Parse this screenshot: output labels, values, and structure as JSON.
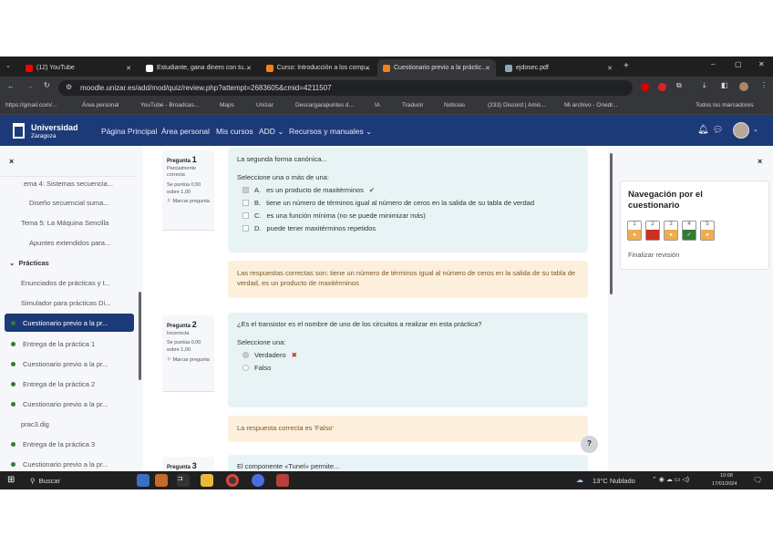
{
  "browser": {
    "tabs": [
      {
        "label": "(12) YouTube",
        "active": false
      },
      {
        "label": "Estudiante, gana dinero con tu...",
        "active": false
      },
      {
        "label": "Curso: Introducción a los comp...",
        "active": false
      },
      {
        "label": "Cuestionario previo a la práctic...",
        "active": true
      },
      {
        "label": "ejdosec.pdf",
        "active": false
      }
    ],
    "url": "moodle.unizar.es/add/mod/quiz/review.php?attempt=2683605&cmid=4211507",
    "bookmarks": [
      "https://gmail.com/...",
      "Área personal",
      "YouTube - Broadcas...",
      "Maps",
      "Unizar",
      "Descargarapuntes d...",
      "IA",
      "Traducir",
      "Noticias",
      "(233) Discord | Amis...",
      "Mi archivo - Onedr..."
    ],
    "all_bookmarks": "Todos los marcadores"
  },
  "moodle": {
    "brand_line1": "Universidad",
    "brand_line2": "Zaragoza",
    "nav": [
      "Página Principal",
      "Área personal",
      "Mis cursos",
      "ADD",
      "Recursos y manuales"
    ]
  },
  "drawer": {
    "close": "×",
    "items": [
      {
        "label": "ema 4: Sistemas secuencia...",
        "dot": false
      },
      {
        "label": "Diseño secuencial suma...",
        "dot": false
      },
      {
        "label": "Tema 5: La Máquina Sencilla",
        "dot": false
      },
      {
        "label": "Apuntes extendidos para...",
        "dot": false
      },
      {
        "label": "Enunciados de prácticas y t...",
        "dot": false
      },
      {
        "label": "Simulador para prácticas Di...",
        "dot": false
      },
      {
        "label": "Cuestionario previo a la pr...",
        "dot": true
      },
      {
        "label": "Entrega de la práctica 1",
        "dot": true
      },
      {
        "label": "Cuestionario previo a la pr...",
        "dot": true
      },
      {
        "label": "Entrega de la práctica 2",
        "dot": true
      },
      {
        "label": "Cuestionario previo a la pr...",
        "dot": true
      },
      {
        "label": "prac3.dig",
        "dot": false
      },
      {
        "label": "Entrega de la práctica 3",
        "dot": true
      },
      {
        "label": "Cuestionario previo a la pr...",
        "dot": true
      }
    ],
    "section": "Prácticas"
  },
  "questions": [
    {
      "title": "Pregunta",
      "num": "1",
      "state": "Parcialmente correcta",
      "score": "Se puntúa 0,50 sobre 1,00",
      "flag": "Marcar pregunta",
      "text": "La segunda forma canónica...",
      "prompt": "Seleccione una o más de una:",
      "options": [
        {
          "letter": "A.",
          "text": "es un producto de maxitérminos"
        },
        {
          "letter": "B.",
          "text": "tiene un número de términos igual al número de ceros en la salida de su tabla de verdad"
        },
        {
          "letter": "C.",
          "text": "es una función mínima (no se puede minimizar más)"
        },
        {
          "letter": "D.",
          "text": "puede tener maxitérminos repetidos"
        }
      ],
      "feedback": "Las respuestas correctas son: tiene un número de términos igual al número de ceros en la salida de su tabla de verdad, es un producto de maxitérminos"
    },
    {
      "title": "Pregunta",
      "num": "2",
      "state": "Incorrecta",
      "score": "Se puntúa 0,00 sobre 1,00",
      "flag": "Marcar pregunta",
      "text": "¿Es el transistor es el nombre de uno de los circuitos a realizar en esta práctica?",
      "prompt": "Seleccione una:",
      "options": [
        {
          "text": "Verdadero"
        },
        {
          "text": "Falso"
        }
      ],
      "feedback": "La respuesta correcta es 'Falso'"
    },
    {
      "title": "Pregunta",
      "num": "3",
      "text": "El componente «Tunel» permite..."
    }
  ],
  "help": "?",
  "quiz_nav": {
    "title": "Navegación por el cuestionario",
    "close": "×",
    "finish": "Finalizar revisión",
    "items": [
      {
        "n": "1",
        "state": "partial",
        "color": "#f0ad4e"
      },
      {
        "n": "2",
        "state": "incorrect",
        "color": "#ca3120"
      },
      {
        "n": "3",
        "state": "partial",
        "color": "#f0ad4e"
      },
      {
        "n": "4",
        "state": "correct",
        "color": "#357a32"
      },
      {
        "n": "5",
        "state": "partial",
        "color": "#f0ad4e"
      }
    ]
  },
  "taskbar": {
    "search": "Buscar",
    "weather": "13°C Nublado",
    "time": "10:08",
    "date": "17/01/2024"
  }
}
